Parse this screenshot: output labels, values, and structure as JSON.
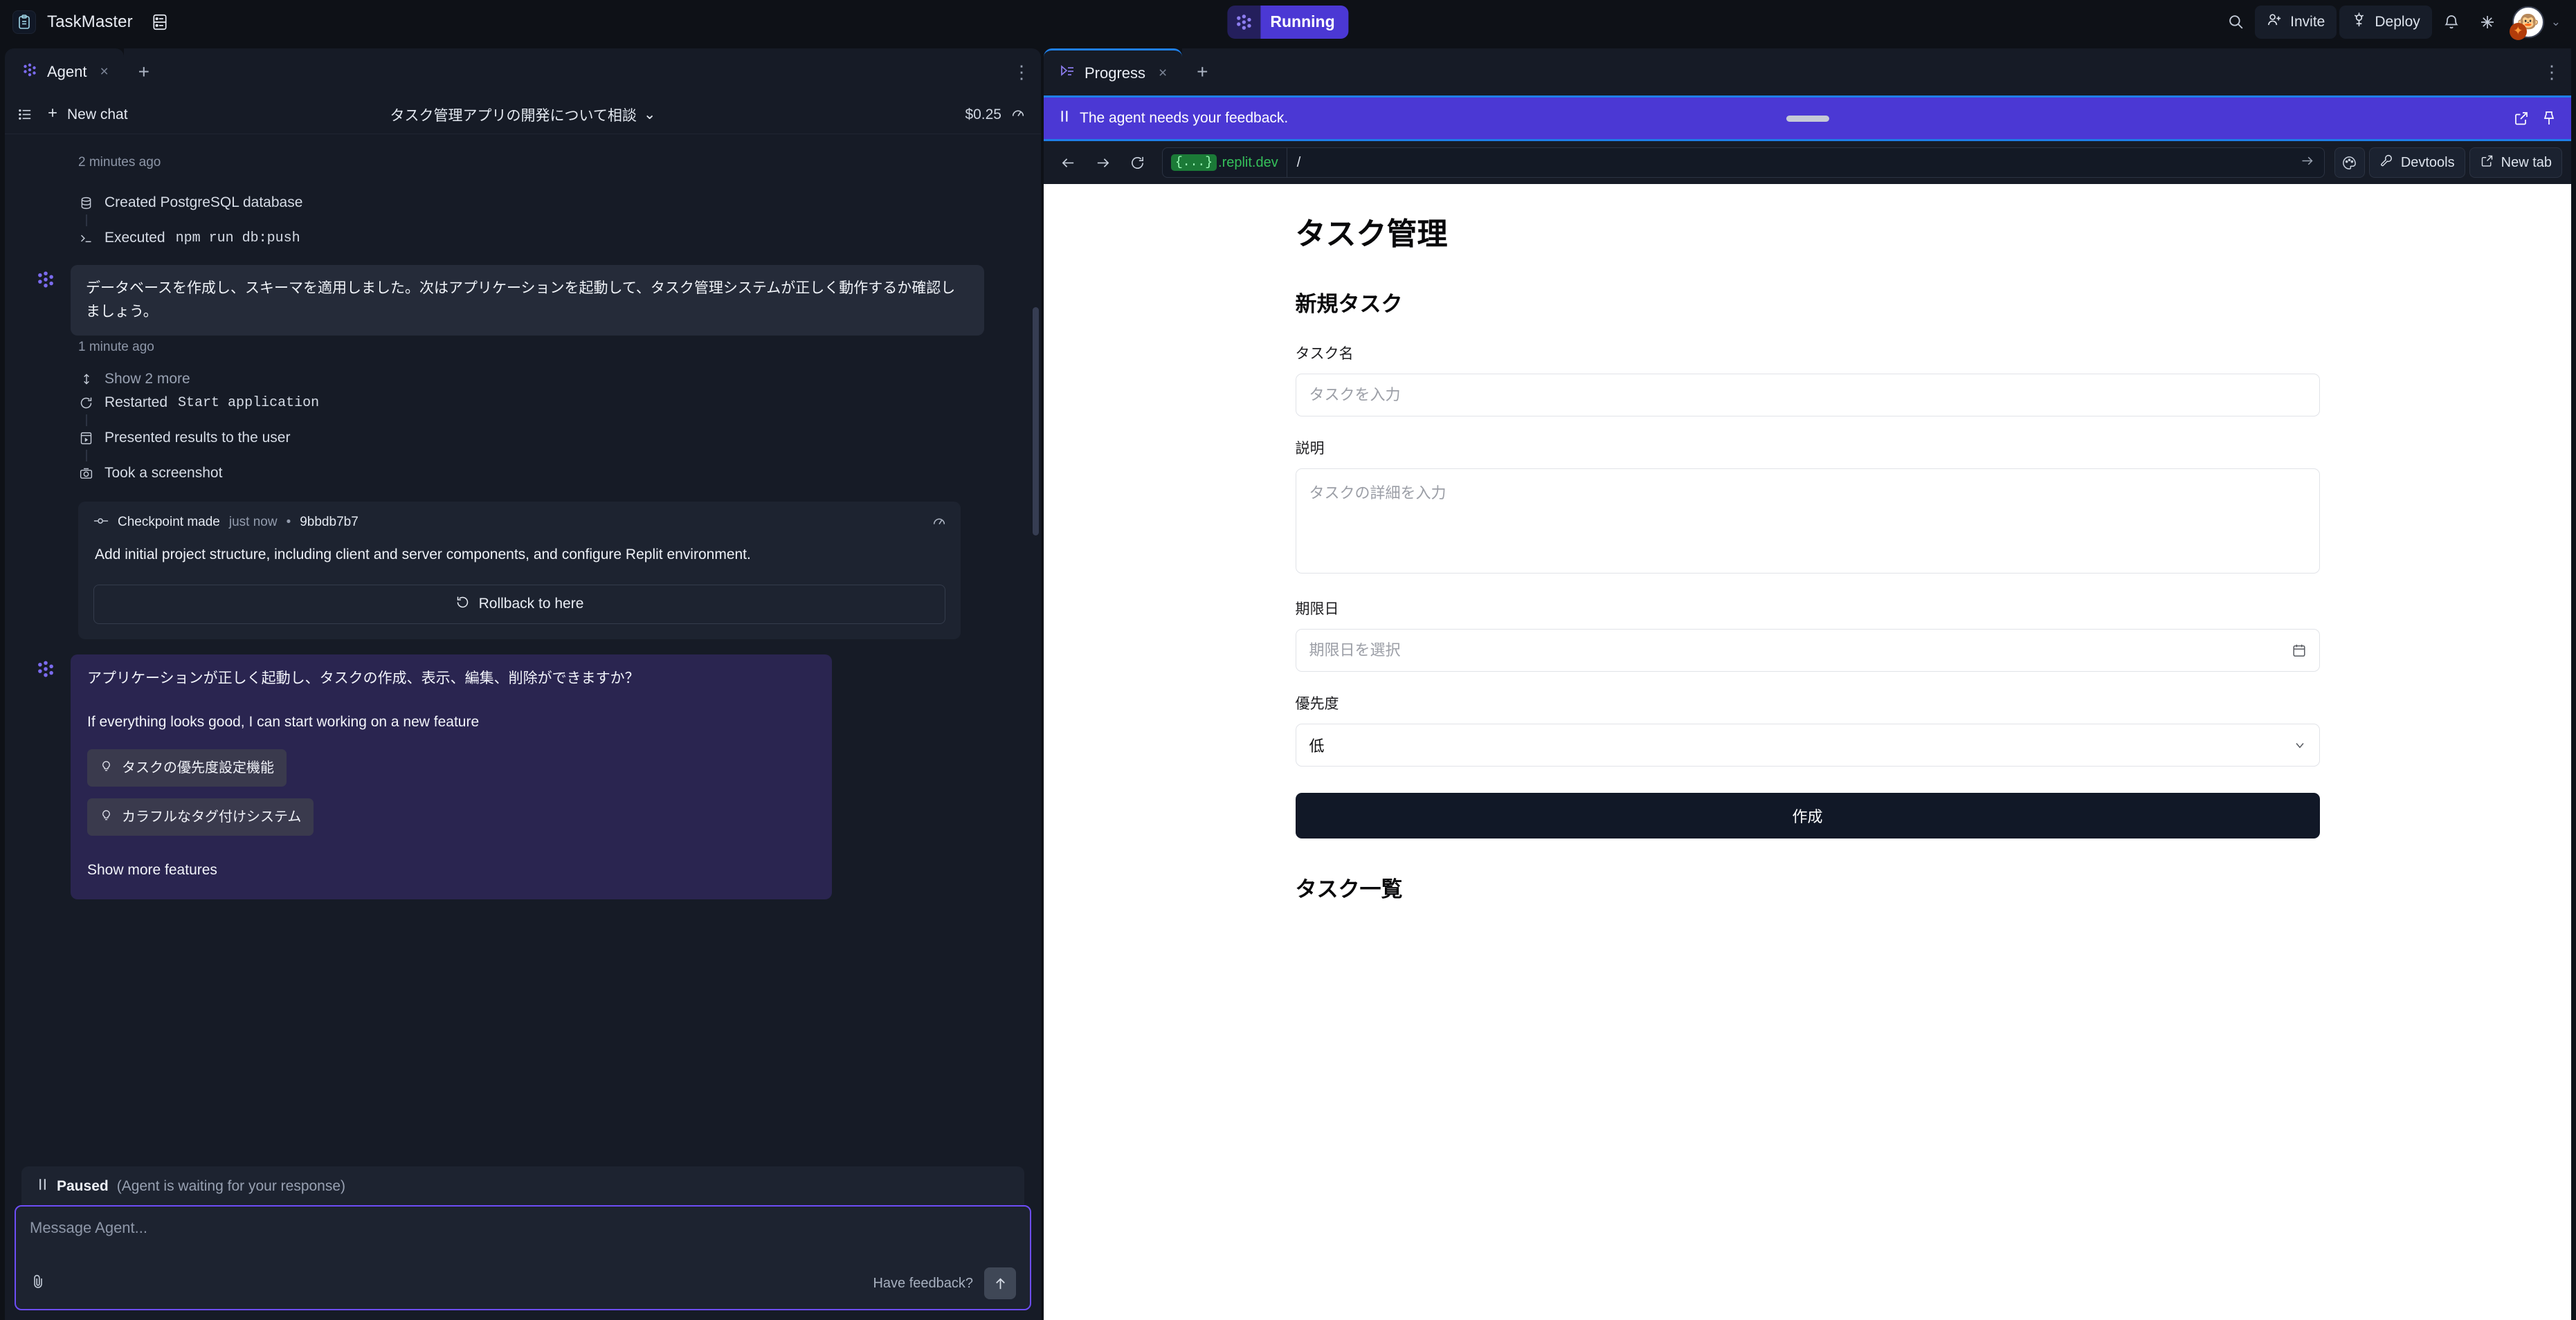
{
  "topbar": {
    "brand_name": "TaskMaster",
    "brand_icon": "clipboard-icon",
    "panels_icon": "panels-icon",
    "status_badge": "Running",
    "search_icon": "search-icon",
    "invite_label": "Invite",
    "invite_icon": "user-plus-icon",
    "deploy_label": "Deploy",
    "deploy_icon": "rocket-icon",
    "bell_icon": "bell-icon",
    "sparkle_icon": "sparkle-icon",
    "avatar_icon": "monkey-avatar",
    "avatar_badge_icon": "sparkle-badge-icon",
    "user_chevron": "chevron-down-icon"
  },
  "left_pane": {
    "tab": {
      "label": "Agent",
      "icon": "agent-icon",
      "close": "×",
      "new_tab": "+",
      "more": "⋮"
    },
    "toolbar": {
      "history_icon": "history-list-icon",
      "new_chat_label": "New chat",
      "new_chat_icon": "plus-icon",
      "chat_title": "タスク管理アプリの開発について相談",
      "chat_title_chevron": "chevron-down-icon",
      "cost": "$0.25",
      "gauge_icon": "gauge-icon"
    },
    "timestamps": {
      "first": "2 minutes ago",
      "second": "1 minute ago"
    },
    "activities_1": [
      {
        "icon": "database-icon",
        "text": "Created PostgreSQL database"
      },
      {
        "icon": "terminal-icon",
        "text": "Executed ",
        "mono": "npm run db:push"
      }
    ],
    "show_more": {
      "label": "Show 2 more",
      "icon": "expand-vertical-icon"
    },
    "activities_2": [
      {
        "icon": "restart-icon",
        "text": "Restarted ",
        "mono": "Start application"
      },
      {
        "icon": "present-icon",
        "text": "Presented results to the user",
        "mono": ""
      },
      {
        "icon": "camera-icon",
        "text": "Took a screenshot",
        "mono": ""
      }
    ],
    "agent_message_1": "データベースを作成し、スキーマを適用しました。次はアプリケーションを起動して、タスク管理システムが正しく動作するか確認しましょう。",
    "checkpoint": {
      "icon": "checkpoint-icon",
      "label": "Checkpoint made",
      "when": "just now",
      "separator": "•",
      "hash": "9bbdb7b7",
      "gauge_icon": "gauge-icon",
      "body": "Add initial project structure, including client and server components, and configure Replit environment.",
      "rollback_label": "Rollback to here",
      "rollback_icon": "rollback-icon"
    },
    "agent_message_2": {
      "question": "アプリケーションが正しく起動し、タスクの作成、表示、編集、削除ができますか？",
      "subtitle": "If everything looks good, I can start working on a new feature",
      "features": [
        {
          "icon": "lightbulb-icon",
          "label": "タスクの優先度設定機能"
        },
        {
          "icon": "lightbulb-icon",
          "label": "カラフルなタグ付けシステム"
        }
      ],
      "show_more_features": "Show more features"
    },
    "composer": {
      "paused_icon": "pause-icon",
      "paused_label": "Paused",
      "paused_note": "(Agent is waiting for your response)",
      "placeholder": "Message Agent...",
      "attach_icon": "paperclip-icon",
      "feedback_label": "Have feedback?",
      "send_icon": "arrow-up-icon"
    }
  },
  "right_pane": {
    "tab": {
      "label": "Progress",
      "icon": "progress-icon",
      "close": "×",
      "new_tab": "+",
      "more": "⋮"
    },
    "banner": {
      "pause_icon": "pause-icon",
      "text": "The agent needs your feedback.",
      "drag_handle": "drag-handle",
      "open_external_icon": "open-external-icon",
      "pin_icon": "pin-icon"
    },
    "urlbar": {
      "back_icon": "arrow-left-icon",
      "forward_icon": "arrow-right-icon",
      "reload_icon": "reload-icon",
      "host_chip": "{...}",
      "host": ".replit.dev",
      "path": "/",
      "go_icon": "arrow-right-icon",
      "palette_icon": "palette-icon",
      "devtools_label": "Devtools",
      "devtools_icon": "wrench-icon",
      "new_tab_label": "New tab",
      "new_tab_icon": "external-link-icon"
    },
    "webview": {
      "page_title": "タスク管理",
      "section_title": "新規タスク",
      "fields": {
        "name_label": "タスク名",
        "name_placeholder": "タスクを入力",
        "desc_label": "説明",
        "desc_placeholder": "タスクの詳細を入力",
        "due_label": "期限日",
        "due_placeholder": "期限日を選択",
        "due_icon": "calendar-icon",
        "priority_label": "優先度",
        "priority_value": "低",
        "priority_icon": "chevron-down-icon"
      },
      "submit_label": "作成",
      "list_title": "タスク一覧"
    }
  },
  "colors": {
    "accent_purple": "#4b38d4",
    "tab_active_blue": "#1f7fe8",
    "app_bg": "#0e1117",
    "panel_bg": "#161b26",
    "green_host": "#35c05a"
  }
}
